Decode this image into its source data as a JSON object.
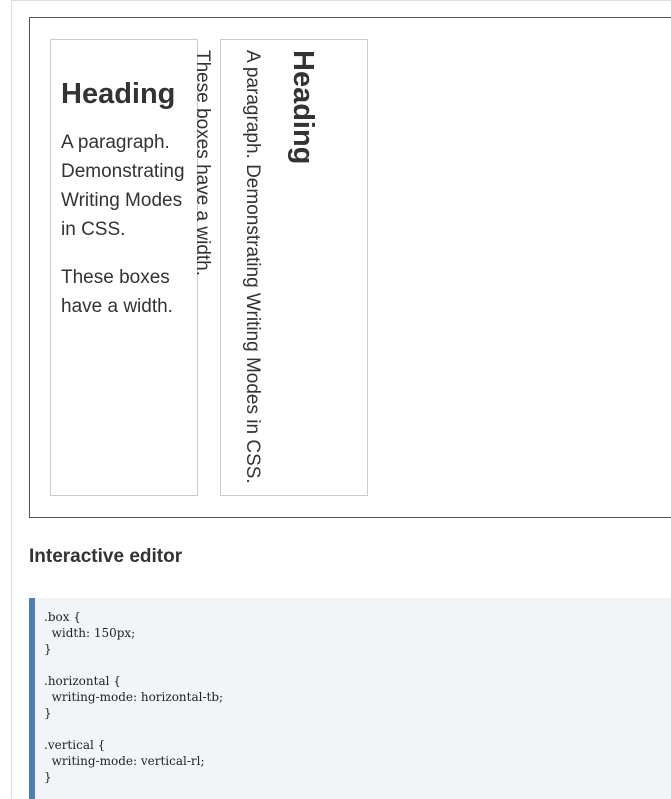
{
  "example": {
    "horizontal_box": {
      "heading": "Heading",
      "paragraph": "A paragraph. Demonstrating Writing Modes in CSS.",
      "note": "These boxes have a width."
    },
    "vertical_box": {
      "heading": "Heading",
      "paragraph": "A paragraph. Demonstrating Writing Modes in CSS.",
      "note": "These boxes have a width."
    }
  },
  "section_title": "Interactive editor",
  "editor": {
    "accent_color": "#4e7fb0",
    "background_color": "#f2f5f7",
    "lines": [
      ".box {",
      "  width: 150px;",
      "}",
      "",
      ".horizontal {",
      "  writing-mode: horizontal-tb;",
      "}",
      "",
      ".vertical {",
      "  writing-mode: vertical-rl;",
      "}"
    ]
  }
}
